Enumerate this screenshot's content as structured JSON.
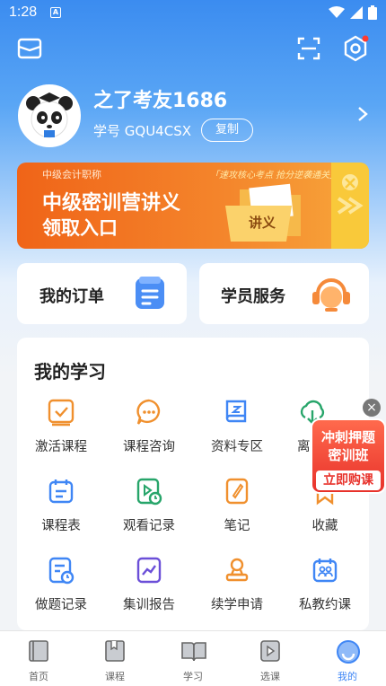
{
  "status_bar": {
    "time": "1:28",
    "notification_badge": "A"
  },
  "header": {
    "icons": [
      "mail-icon",
      "scan-icon",
      "settings-icon"
    ]
  },
  "profile": {
    "username": "之了考友1686",
    "student_id": "学号 GQU4CSX",
    "copy_label": "复制"
  },
  "banner": {
    "tag": "中级会计职称",
    "slogan": "「速攻核心考点 抢分逆袭通关」",
    "title_line1": "中级密训营讲义",
    "title_line2": "领取入口",
    "folder_text": "讲义"
  },
  "quick_cards": {
    "orders_label": "我的订单",
    "service_label": "学员服务"
  },
  "learning": {
    "title": "我的学习",
    "items": [
      {
        "label": "激活课程",
        "icon": "activate-icon"
      },
      {
        "label": "课程咨询",
        "icon": "chat-icon"
      },
      {
        "label": "资料专区",
        "icon": "book-icon"
      },
      {
        "label": "离线缓存",
        "icon": "download-icon"
      },
      {
        "label": "课程表",
        "icon": "schedule-icon"
      },
      {
        "label": "观看记录",
        "icon": "play-history-icon"
      },
      {
        "label": "笔记",
        "icon": "note-icon"
      },
      {
        "label": "收藏",
        "icon": "bookmark-icon"
      },
      {
        "label": "做题记录",
        "icon": "exercise-history-icon"
      },
      {
        "label": "集训报告",
        "icon": "report-icon"
      },
      {
        "label": "续学申请",
        "icon": "stamp-icon"
      },
      {
        "label": "私教约课",
        "icon": "tutor-icon"
      }
    ]
  },
  "promo": {
    "line1": "冲刺押题",
    "line2": "密训班",
    "buy_label": "立即购课"
  },
  "bottom_nav": {
    "items": [
      {
        "label": "首页"
      },
      {
        "label": "课程"
      },
      {
        "label": "学习"
      },
      {
        "label": "选课"
      },
      {
        "label": "我的"
      }
    ],
    "active": "我的",
    "active_color": "#3f86f5"
  },
  "colors": {
    "primary_blue": "#3b8cf0",
    "icon_blue": "#3f86f5",
    "icon_orange": "#f08a2a",
    "icon_green": "#27a56a",
    "icon_purple": "#6b4fd8",
    "banner_orange": "#f06418"
  }
}
